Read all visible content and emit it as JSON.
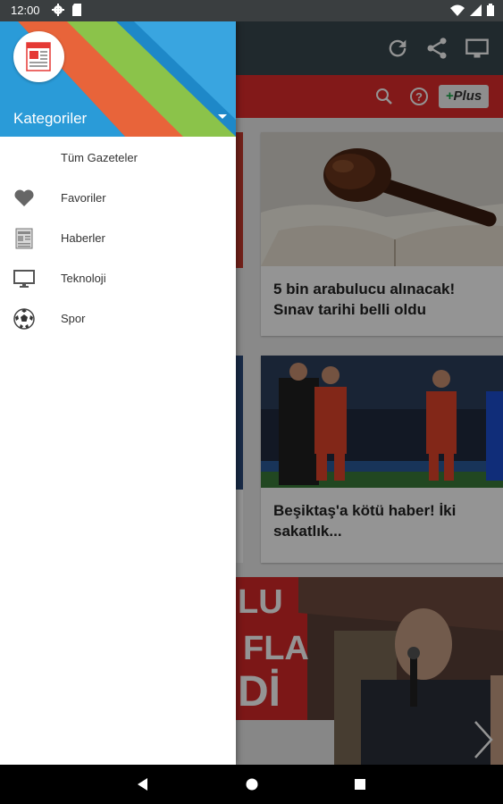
{
  "status_bar": {
    "time": "12:00",
    "left_icons": [
      "settings-icon",
      "sd-card-icon"
    ],
    "right_icons": [
      "wifi-icon",
      "cell-signal-icon",
      "battery-icon"
    ],
    "background_color": "#3a3e40"
  },
  "toolbar": {
    "icons": [
      "refresh-icon",
      "share-icon",
      "cast-icon"
    ],
    "background_color": "#37474f"
  },
  "red_bar": {
    "icons": [
      "search-icon",
      "help-icon"
    ],
    "plus_badge": "Plus",
    "background_color": "#e02b2b"
  },
  "articles": [
    {
      "title": "5 bin arabulucu alınacak! Sınav tarihi belli oldu",
      "image": "gavel-and-book"
    },
    {
      "title": "Beşiktaş'a kötü haber! İki sakatlık...",
      "image": "football-players"
    },
    {
      "image_text": [
        "LU",
        "FLA",
        "Dİ"
      ],
      "image": "politician-speaking"
    }
  ],
  "drawer": {
    "header_label": "Kategoriler",
    "items": [
      {
        "label": "Tüm Gazeteler",
        "icon": ""
      },
      {
        "label": "Favoriler",
        "icon": "heart-icon"
      },
      {
        "label": "Haberler",
        "icon": "newspaper-icon"
      },
      {
        "label": "Teknoloji",
        "icon": "monitor-icon"
      },
      {
        "label": "Spor",
        "icon": "soccer-ball-icon"
      }
    ]
  },
  "nav_bar": {
    "icons": [
      "back-icon",
      "home-icon",
      "recents-icon"
    ]
  }
}
